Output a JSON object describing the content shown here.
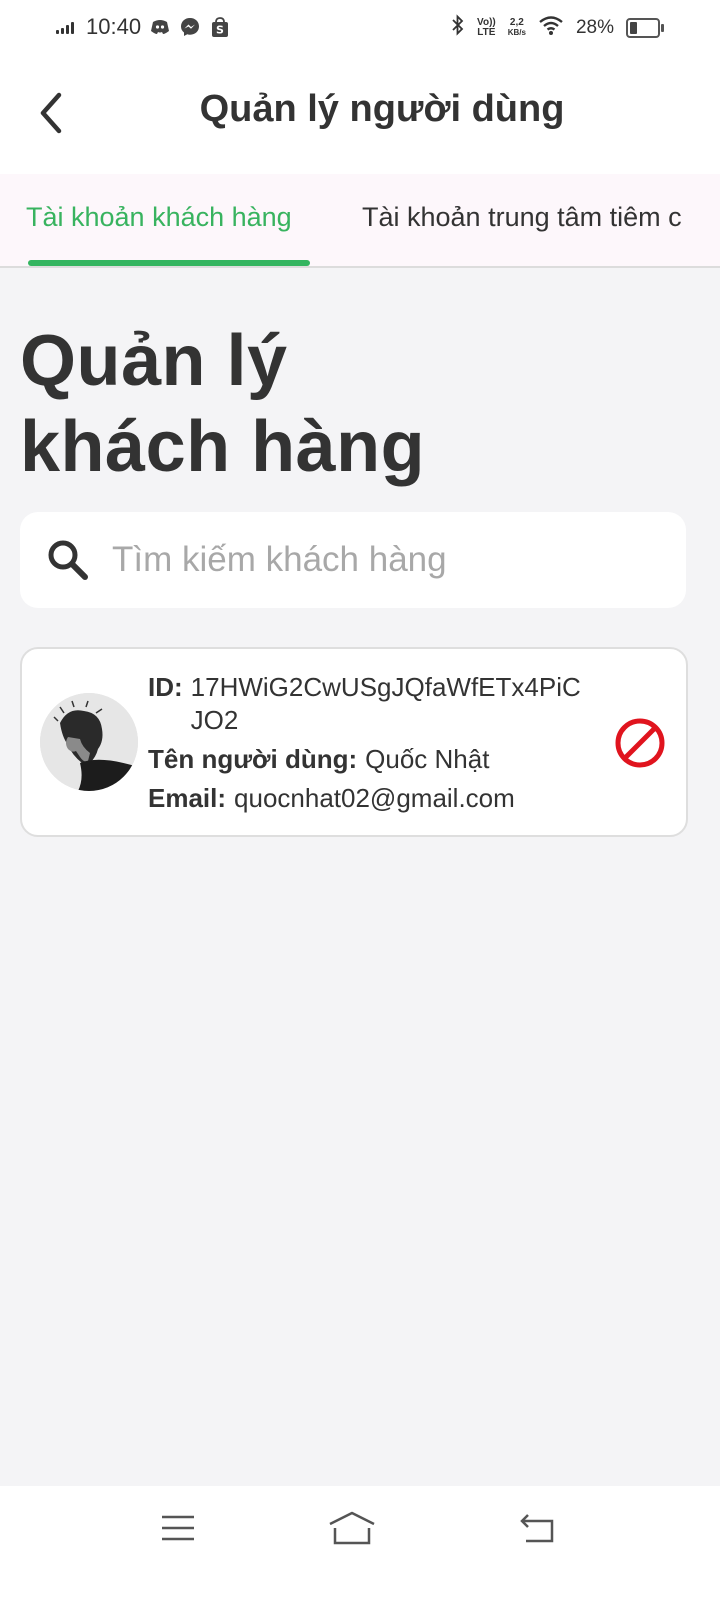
{
  "status_bar": {
    "time": "10:40",
    "network_speed_value": "2,2",
    "network_speed_unit": "KB/s",
    "volte_label_top": "Vo))",
    "volte_label_bottom": "LTE",
    "battery_percent_text": "28%",
    "battery_level": 0.28,
    "notification_icons": [
      "discord-icon",
      "messenger-icon",
      "shopee-icon"
    ]
  },
  "header": {
    "title": "Quản lý người dùng"
  },
  "tabs": [
    {
      "label": "Tài khoản khách hàng",
      "active": true
    },
    {
      "label": "Tài khoản trung tâm tiêm c",
      "active": false
    }
  ],
  "section": {
    "title_line1": "Quản lý",
    "title_line2": "khách hàng"
  },
  "search": {
    "placeholder": "Tìm kiếm khách hàng",
    "value": ""
  },
  "customers": [
    {
      "id_label": "ID:",
      "id_value": "17HWiG2CwUSgJQfaWfETx4PiCJO2",
      "name_label": "Tên người dùng:",
      "name_value": "Quốc Nhật",
      "email_label": "Email:",
      "email_value": "quocnhat02@gmail.com",
      "action_icon": "block-icon"
    }
  ],
  "colors": {
    "accent_green": "#38b35f",
    "block_red": "#e0141e",
    "background": "#f4f4f6",
    "tab_bg": "#fdf7fb"
  }
}
